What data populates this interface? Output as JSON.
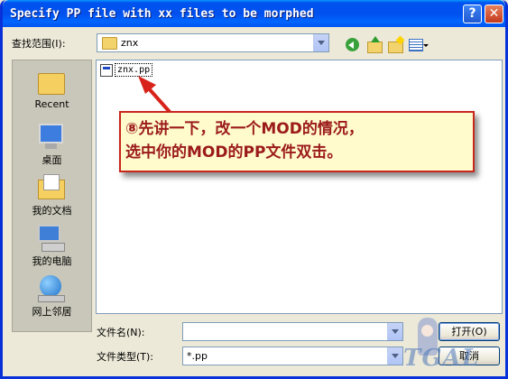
{
  "window": {
    "title": "Specify PP file with xx files to be morphed",
    "help_glyph": "?",
    "close_glyph": "✕"
  },
  "lookin": {
    "label": "查找范围(I):",
    "value": "znx"
  },
  "toolbar": {
    "icons": [
      "back-icon",
      "up-folder-icon",
      "new-folder-icon",
      "view-menu-icon"
    ]
  },
  "places": [
    {
      "label": "Recent",
      "icon": "recent-icon"
    },
    {
      "label": "桌面",
      "icon": "desktop-icon"
    },
    {
      "label": "我的文档",
      "icon": "my-documents-icon"
    },
    {
      "label": "我的电脑",
      "icon": "my-computer-icon"
    },
    {
      "label": "网上邻居",
      "icon": "network-icon"
    }
  ],
  "files": [
    {
      "name": "znx.pp",
      "icon": "pp-file-icon"
    }
  ],
  "annotation": {
    "line1": "⑧先讲一下，改一个MOD的情况，",
    "line2": "选中你的MOD的PP文件双击。",
    "border_color": "#c8261c",
    "text_color": "#9b1b1b"
  },
  "filename": {
    "label": "文件名(N):",
    "value": ""
  },
  "filetype": {
    "label": "文件类型(T):",
    "value": "*.pp"
  },
  "buttons": {
    "open": "打开(O)",
    "cancel": "取消"
  }
}
